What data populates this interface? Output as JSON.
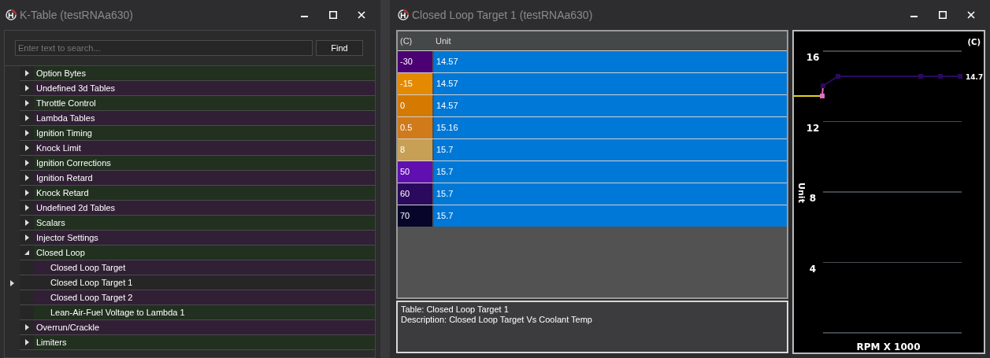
{
  "left_window": {
    "title": "K-Table (testRNAa630)",
    "search": {
      "placeholder": "Enter text to search..."
    },
    "find_button": "Find",
    "tree": [
      {
        "label": "Option Bytes",
        "expanded": false
      },
      {
        "label": "Undefined 3d Tables",
        "expanded": false
      },
      {
        "label": "Throttle Control",
        "expanded": false
      },
      {
        "label": "Lambda Tables",
        "expanded": false
      },
      {
        "label": "Ignition Timing",
        "expanded": false
      },
      {
        "label": "Knock Limit",
        "expanded": false
      },
      {
        "label": "Ignition Corrections",
        "expanded": false
      },
      {
        "label": "Ignition Retard",
        "expanded": false
      },
      {
        "label": "Knock Retard",
        "expanded": false
      },
      {
        "label": "Undefined 2d Tables",
        "expanded": false
      },
      {
        "label": "Scalars",
        "expanded": false
      },
      {
        "label": "Injector Settings",
        "expanded": false
      },
      {
        "label": "Closed Loop",
        "expanded": true,
        "children": [
          {
            "label": "Closed Loop Target",
            "selected": false
          },
          {
            "label": "Closed Loop Target 1",
            "selected": true
          },
          {
            "label": "Closed Loop Target 2",
            "selected": false
          },
          {
            "label": "Lean-Air-Fuel Voltage to Lambda 1",
            "selected": false
          }
        ]
      },
      {
        "label": "Overrun/Crackle",
        "expanded": false
      },
      {
        "label": "Limiters",
        "expanded": false
      }
    ]
  },
  "right_window": {
    "title": "Closed Loop Target 1 (testRNAa630)",
    "table": {
      "columns": [
        "(C)",
        "Unit"
      ],
      "rows": [
        {
          "axis": "-30",
          "color": "#4b0073",
          "value": "14.57"
        },
        {
          "axis": "-15",
          "color": "#e58a00",
          "value": "14.57"
        },
        {
          "axis": "0",
          "color": "#d47a00",
          "value": "14.57"
        },
        {
          "axis": "0.5",
          "color": "#d07a1a",
          "value": "15.16"
        },
        {
          "axis": "8",
          "color": "#c8a055",
          "value": "15.7"
        },
        {
          "axis": "50",
          "color": "#6010b0",
          "value": "15.7"
        },
        {
          "axis": "60",
          "color": "#2b0a5e",
          "value": "15.7"
        },
        {
          "axis": "70",
          "color": "#07052a",
          "value": "15.7"
        }
      ]
    },
    "description": [
      "Table: Closed Loop Target 1",
      "Description: Closed Loop Target Vs Coolant Temp"
    ],
    "graph": {
      "corner_label": "(C)",
      "y_ticks": [
        "16",
        "12",
        "8",
        "4"
      ],
      "y_label": "Unit",
      "x_label": "RPM X 1000",
      "end_value": "14.7"
    }
  }
}
